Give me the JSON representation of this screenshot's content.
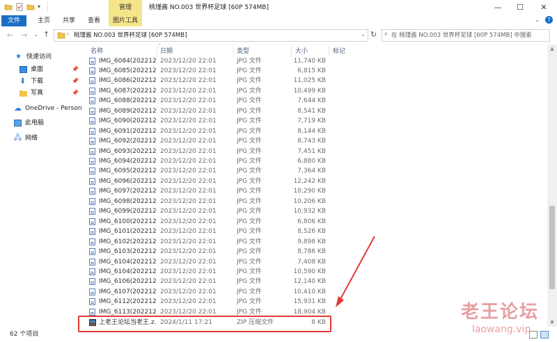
{
  "titlebar": {
    "context_tab": "管理",
    "title": "桃瑾酱 NO.003 世界杯足球 [60P 574MB]",
    "minimize": "—",
    "maximize": "☐",
    "close": "✕"
  },
  "ribbon": {
    "tabs": [
      "文件",
      "主页",
      "共享",
      "查看",
      "图片工具"
    ]
  },
  "address": {
    "path": "桃瑾酱 NO.003 世界杯足球 [60P 574MB]",
    "search_placeholder": "在 桃瑾酱 NO.003 世界杯足球 [60P 574MB] 中搜索"
  },
  "nav": {
    "items": [
      {
        "label": "快速访问",
        "icon": "star-icon"
      },
      {
        "label": "桌面",
        "icon": "desktop-icon"
      },
      {
        "label": "下载",
        "icon": "download-icon"
      },
      {
        "label": "写真",
        "icon": "folder-icon"
      },
      {
        "label": "OneDrive - Persona",
        "icon": "cloud-icon"
      },
      {
        "label": "此电脑",
        "icon": "computer-icon"
      },
      {
        "label": "网络",
        "icon": "network-icon"
      }
    ]
  },
  "columns": [
    "名称",
    "日期",
    "类型",
    "大小",
    "标记"
  ],
  "files": [
    {
      "name": "IMG_6084(202212...",
      "date": "2023/12/20 22:01",
      "type": "JPG 文件",
      "size": "11,740 KB"
    },
    {
      "name": "IMG_6085(202212...",
      "date": "2023/12/20 22:01",
      "type": "JPG 文件",
      "size": "6,815 KB"
    },
    {
      "name": "IMG_6086(202212...",
      "date": "2023/12/20 22:01",
      "type": "JPG 文件",
      "size": "11,025 KB"
    },
    {
      "name": "IMG_6087(202212...",
      "date": "2023/12/20 22:01",
      "type": "JPG 文件",
      "size": "10,499 KB"
    },
    {
      "name": "IMG_6088(202212...",
      "date": "2023/12/20 22:01",
      "type": "JPG 文件",
      "size": "7,644 KB"
    },
    {
      "name": "IMG_6089(202212...",
      "date": "2023/12/20 22:01",
      "type": "JPG 文件",
      "size": "8,541 KB"
    },
    {
      "name": "IMG_6090(202212...",
      "date": "2023/12/20 22:01",
      "type": "JPG 文件",
      "size": "7,719 KB"
    },
    {
      "name": "IMG_6091(202212...",
      "date": "2023/12/20 22:01",
      "type": "JPG 文件",
      "size": "8,144 KB"
    },
    {
      "name": "IMG_6092(202212...",
      "date": "2023/12/20 22:01",
      "type": "JPG 文件",
      "size": "8,743 KB"
    },
    {
      "name": "IMG_6093(202212...",
      "date": "2023/12/20 22:01",
      "type": "JPG 文件",
      "size": "7,451 KB"
    },
    {
      "name": "IMG_6094(202212...",
      "date": "2023/12/20 22:01",
      "type": "JPG 文件",
      "size": "6,880 KB"
    },
    {
      "name": "IMG_6095(202212...",
      "date": "2023/12/20 22:01",
      "type": "JPG 文件",
      "size": "7,364 KB"
    },
    {
      "name": "IMG_6096(202212...",
      "date": "2023/12/20 22:01",
      "type": "JPG 文件",
      "size": "12,242 KB"
    },
    {
      "name": "IMG_6097(202212...",
      "date": "2023/12/20 22:01",
      "type": "JPG 文件",
      "size": "10,290 KB"
    },
    {
      "name": "IMG_6098(202212...",
      "date": "2023/12/20 22:01",
      "type": "JPG 文件",
      "size": "10,206 KB"
    },
    {
      "name": "IMG_6099(202212...",
      "date": "2023/12/20 22:01",
      "type": "JPG 文件",
      "size": "10,932 KB"
    },
    {
      "name": "IMG_6100(202212...",
      "date": "2023/12/20 22:01",
      "type": "JPG 文件",
      "size": "6,806 KB"
    },
    {
      "name": "IMG_6101(202212...",
      "date": "2023/12/20 22:01",
      "type": "JPG 文件",
      "size": "8,526 KB"
    },
    {
      "name": "IMG_6102(202212...",
      "date": "2023/12/20 22:01",
      "type": "JPG 文件",
      "size": "9,898 KB"
    },
    {
      "name": "IMG_6103(202212...",
      "date": "2023/12/20 22:01",
      "type": "JPG 文件",
      "size": "8,786 KB"
    },
    {
      "name": "IMG_6104(202212...",
      "date": "2023/12/20 22:01",
      "type": "JPG 文件",
      "size": "7,408 KB"
    },
    {
      "name": "IMG_6104(202212...",
      "date": "2023/12/20 22:01",
      "type": "JPG 文件",
      "size": "10,590 KB"
    },
    {
      "name": "IMG_6106(202212...",
      "date": "2023/12/20 22:01",
      "type": "JPG 文件",
      "size": "12,140 KB"
    },
    {
      "name": "IMG_6107(202212...",
      "date": "2023/12/20 22:01",
      "type": "JPG 文件",
      "size": "10,410 KB"
    },
    {
      "name": "IMG_6112(202212...",
      "date": "2023/12/20 22:01",
      "type": "JPG 文件",
      "size": "15,931 KB"
    },
    {
      "name": "IMG_6113(202212...",
      "date": "2023/12/20 22:01",
      "type": "JPG 文件",
      "size": "18,904 KB"
    },
    {
      "name": "上老王论坛当老王.z...",
      "date": "2024/1/11 17:21",
      "type": "ZIP 压缩文件",
      "size": "8 KB",
      "zip": true
    }
  ],
  "status": {
    "count": "62 个项目"
  },
  "watermark": {
    "logo": "老王论坛",
    "url": "laowang.vip"
  },
  "colors": {
    "file_tab": "#1a6fc4",
    "context_tab": "#f5e58a",
    "highlight": "#e53935"
  }
}
